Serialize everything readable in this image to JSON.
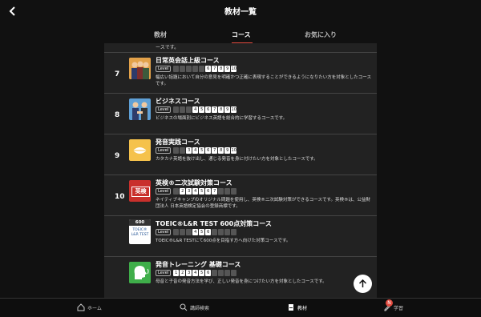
{
  "header": {
    "title": "教材一覧",
    "back_icon": "chevron-left-icon"
  },
  "tabs": [
    {
      "label": "教材",
      "active": false
    },
    {
      "label": "コース",
      "active": true
    },
    {
      "label": "お気に入り",
      "active": false
    }
  ],
  "accent_color": "#e24a3e",
  "list": {
    "prev_tail": "ースです。",
    "level_label": "Level",
    "courses": [
      {
        "number": "7",
        "title": "日常英会話上級コース",
        "levels_shown": [
          "6",
          "7",
          "8",
          "9",
          "10"
        ],
        "description": "幅広い話題において自分の意見を明確かつ正確に表現することができるようになりたい方を対象としたコースです。",
        "thumb": "business-people-icon"
      },
      {
        "number": "8",
        "title": "ビジネスコース",
        "levels_shown": [
          "4",
          "5",
          "6",
          "7",
          "8",
          "9",
          "10"
        ],
        "description": "ビジネスの場面別にビジネス英語を総合的に学習するコースです。",
        "thumb": "handshake-icon"
      },
      {
        "number": "9",
        "title": "発音実践コース",
        "levels_shown": [
          "3",
          "4",
          "5",
          "6",
          "7",
          "8",
          "9",
          "10"
        ],
        "description": "カタカナ英語を抜け出し、通じる発音を身に付けたい方を対象としたコースです。",
        "thumb": "lips-icon"
      },
      {
        "number": "10",
        "title": "英検®二次試験対策コース",
        "levels_shown": [
          "2",
          "3",
          "4",
          "5",
          "6",
          "7"
        ],
        "description": "ネイティブキャンプのオリジナル問題を使用し、英検®二次試験対策ができるコースです。英検®は、公益財団法人 日本英語検定協会の登録商標です。",
        "thumb": "eiken-icon",
        "thumb_text": "英検"
      },
      {
        "number": "",
        "title": "TOEIC®L&R TEST 600点対策コース",
        "levels_shown": [
          "4",
          "5",
          "6"
        ],
        "description": "TOEIC®L&R TESTにて600点を目指す方へ向けた対策コースです。",
        "thumb": "toeic-icon",
        "thumb_text_top": "600",
        "thumb_text_mid": "TOEIC®",
        "thumb_text_bot": "L&R TEST"
      },
      {
        "number": "",
        "title": "発音トレーニング 基礎コース",
        "levels_shown": [
          "1",
          "2",
          "3",
          "4",
          "5",
          "6"
        ],
        "description": "母音と子音の発音方法を学び、正しい発音を身につけたい方を対象としたコースです。",
        "thumb": "speaking-head-icon"
      }
    ]
  },
  "bottom_nav": [
    {
      "label": "ホーム",
      "icon": "home-icon"
    },
    {
      "label": "講師検索",
      "icon": "search-icon"
    },
    {
      "label": "教材",
      "icon": "book-icon",
      "active": true
    },
    {
      "label": "学習",
      "icon": "pencil-icon",
      "badge": "N"
    }
  ]
}
